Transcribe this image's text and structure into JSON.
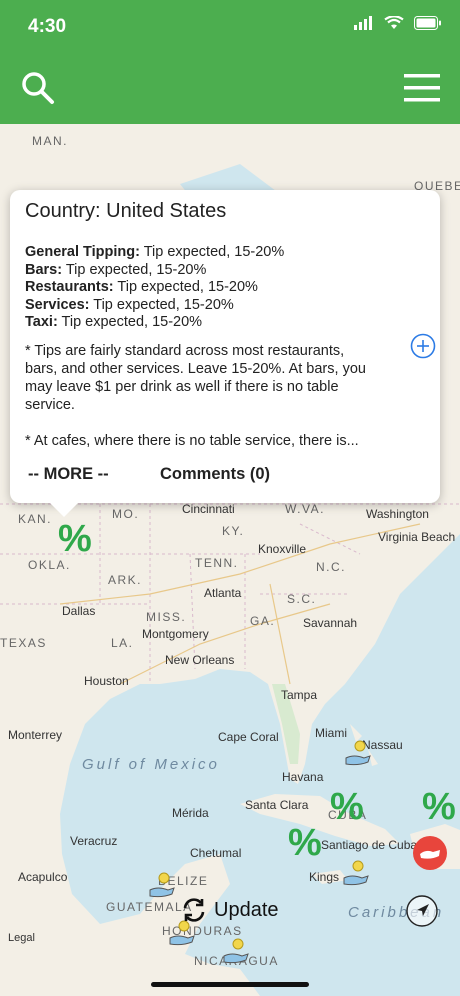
{
  "status_bar": {
    "time": "4:30"
  },
  "header": {
    "search_icon": "search-icon",
    "menu_icon": "hamburger-menu-icon"
  },
  "popup": {
    "title": "Country: United States",
    "rows": [
      {
        "label": "General Tipping:",
        "value": " Tip expected, 15-20%"
      },
      {
        "label": "Bars:",
        "value": " Tip expected, 15-20%"
      },
      {
        "label": "Restaurants:",
        "value": " Tip expected, 15-20%"
      },
      {
        "label": "Services:",
        "value": " Tip expected, 15-20%"
      },
      {
        "label": "Taxi:",
        "value": " Tip expected, 15-20%"
      }
    ],
    "desc1": "* Tips are fairly standard across most restaurants, bars, and other services. Leave 15-20%. At bars, you may leave $1 per drink as well if there is no table service.",
    "desc2": "* At cafes, where there is no table service, there is...",
    "more_label": "-- MORE --",
    "comments_label": "Comments (0)"
  },
  "map": {
    "labels": {
      "man": "MAN.",
      "quebec": "QUEBEC",
      "kan": "KAN.",
      "mo": "MO.",
      "ky": "KY.",
      "wva": "W.VA.",
      "okla": "OKLA.",
      "ark": "ARK.",
      "tenn": "TENN.",
      "nc": "N.C.",
      "miss": "MISS.",
      "ga": "GA.",
      "sc": "S.C.",
      "la": "LA.",
      "texas": "TEXAS",
      "cuba": "CUBA",
      "belize": "BELIZE",
      "guatemala": "GUATEMALA",
      "honduras": "HONDURAS",
      "nicaragua": "NICARAGUA"
    },
    "cities": {
      "cincinnati": "Cincinnati",
      "washington": "Washington",
      "knoxville": "Knoxville",
      "virginia_beach": "Virginia Beach",
      "dallas": "Dallas",
      "atlanta": "Atlanta",
      "montgomery": "Montgomery",
      "savannah": "Savannah",
      "new_orleans": "New Orleans",
      "houston": "Houston",
      "tampa": "Tampa",
      "cape_coral": "Cape Coral",
      "miami": "Miami",
      "nassau": "Nassau",
      "monterrey": "Monterrey",
      "havana": "Havana",
      "santa_clara": "Santa Clara",
      "merida": "Mérida",
      "veracruz": "Veracruz",
      "santiago": "Santiago de Cuba",
      "chetumal": "Chetumal",
      "acapulco": "Acapulco",
      "kingston": "Kings"
    },
    "seas": {
      "gulf": "Gulf of Mexico",
      "caribbean": "Caribbean"
    },
    "percent_symbol": "%"
  },
  "update_label": "Update",
  "legal_label": "Legal",
  "colors": {
    "header": "#4cae4f",
    "percent": "#2fa84a",
    "accent": "#2c7be5",
    "red": "#e8453c"
  }
}
